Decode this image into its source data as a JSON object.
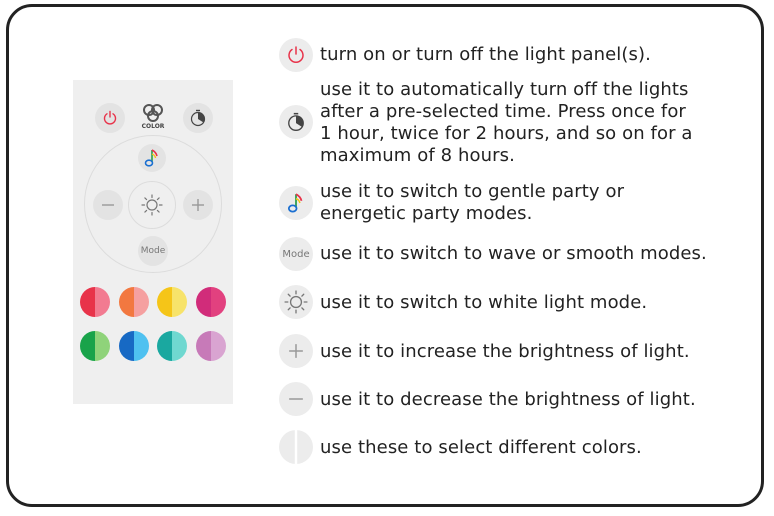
{
  "remote": {
    "color_label": "COLOR",
    "mode_label": "Mode",
    "swatches": [
      {
        "left": "#e8334a",
        "right": "#f27b91"
      },
      {
        "left": "#f27840",
        "right": "#f5a0a0"
      },
      {
        "left": "#f5c518",
        "right": "#f7e36a"
      },
      {
        "left": "#d12c7a",
        "right": "#e2417f"
      },
      {
        "left": "#19a34a",
        "right": "#8fd37a"
      },
      {
        "left": "#1769c4",
        "right": "#4fc1f0"
      },
      {
        "left": "#1aa8a0",
        "right": "#6fd8d0"
      },
      {
        "left": "#c77ab8",
        "right": "#d9a4d1"
      }
    ]
  },
  "legend": [
    {
      "icon": "power-icon",
      "text": "turn on or turn off the light panel(s)."
    },
    {
      "icon": "timer-icon",
      "text": "use it to automatically turn off the lights after a pre-selected time. Press once for 1 hour, twice for 2 hours, and so on for a maximum of 8 hours."
    },
    {
      "icon": "music-note-icon",
      "text": "use it to switch to gentle party or energetic party modes."
    },
    {
      "icon": "mode-icon",
      "icon_text": "Mode",
      "text": "use it to switch to wave or smooth modes."
    },
    {
      "icon": "sun-icon",
      "text": "use it to switch to white light mode."
    },
    {
      "icon": "plus-icon",
      "text": "use it to increase the brightness of light."
    },
    {
      "icon": "minus-icon",
      "text": "use it to decrease the brightness of light."
    },
    {
      "icon": "color-select-icon",
      "text": "use these to select different colors."
    }
  ],
  "colors": {
    "power": "#e8334a",
    "border": "#222222"
  }
}
